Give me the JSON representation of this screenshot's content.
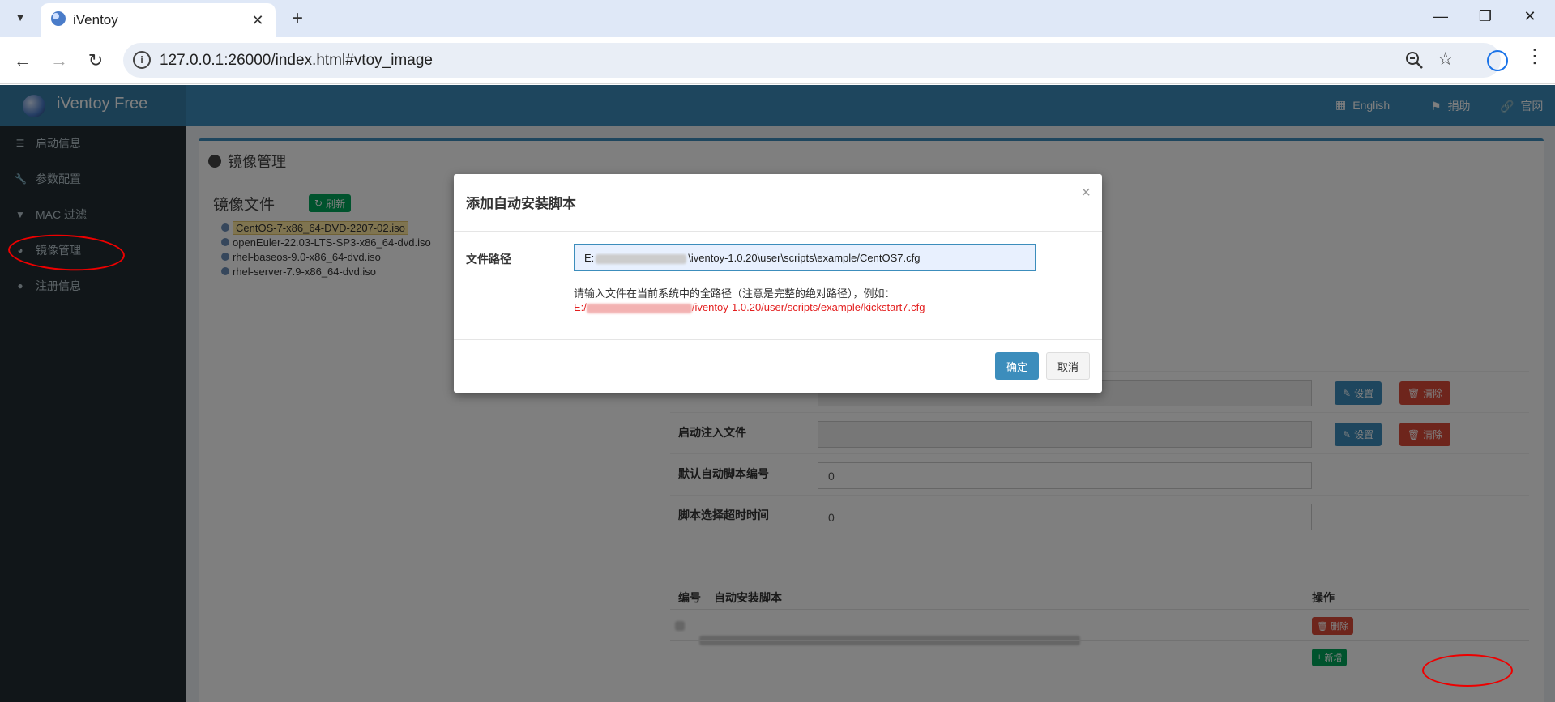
{
  "browser": {
    "tab_title": "iVentoy",
    "url": "127.0.0.1:26000/index.html#vtoy_image"
  },
  "app": {
    "brand": "iVentoy Free",
    "header_links": [
      "English",
      "捐助",
      "官网"
    ],
    "sidebar_items": [
      "启动信息",
      "参数配置",
      "MAC 过滤",
      "镜像管理",
      "注册信息"
    ],
    "sidebar_icons": [
      "list-icon",
      "wrench-icon",
      "filter-icon",
      "globe-icon",
      "user-icon"
    ],
    "active_sidebar_item": "镜像管理"
  },
  "page": {
    "title": "镜像管理",
    "image_files_heading": "镜像文件",
    "refresh_label": "刷新",
    "image_files": [
      "CentOS-7-x86_64-DVD-2207-02.iso",
      "openEuler-22.03-LTS-SP3-x86_64-dvd.iso",
      "rhel-baseos-9.0-x86_64-dvd.iso",
      "rhel-server-7.9-x86_64-dvd.iso"
    ],
    "selected_file": "CentOS-7-x86_64-DVD-2207-02.iso",
    "fields": {
      "boot_inject_label": "启动注入文件",
      "default_script_label": "默认自动脚本编号",
      "default_script_value": "0",
      "timeout_label": "脚本选择超时时间",
      "timeout_value": "0",
      "set_label": "设置",
      "clear_label": "清除"
    },
    "script_table": {
      "col_number": "编号",
      "col_script": "自动安装脚本",
      "col_action": "操作",
      "delete_label": "删除",
      "add_label": "新增"
    }
  },
  "modal": {
    "title": "添加自动安装脚本",
    "file_path_label": "文件路径",
    "file_path_value_prefix": "E:",
    "file_path_value_suffix": "\\iventoy-1.0.20\\user\\scripts\\example/CentOS7.cfg",
    "hint": "请输入文件在当前系统中的全路径（注意是完整的绝对路径），例如：",
    "example_prefix": "E:/",
    "example_suffix": "/iventoy-1.0.20/user/scripts/example/kickstart7.cfg",
    "ok_label": "确定",
    "cancel_label": "取消"
  },
  "colors": {
    "header_blue": "#3c8dbc",
    "sidebar_dark": "#222d32",
    "success_green": "#00a65a",
    "danger_red": "#dd4b39",
    "annotation_red": "#e00000"
  }
}
